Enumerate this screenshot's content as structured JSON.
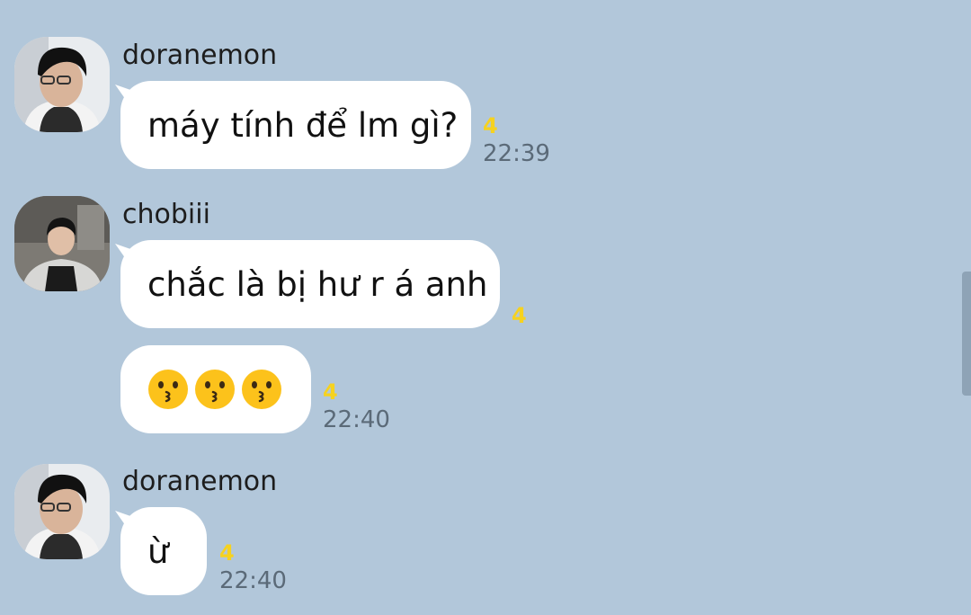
{
  "messages": [
    {
      "sender": "doranemon",
      "avatar_icon": "profile-photo-doranemon",
      "bubbles": [
        {
          "text": "máy tính để lm gì?",
          "unread": "4",
          "time": "22:39"
        }
      ]
    },
    {
      "sender": "chobiii",
      "avatar_icon": "profile-photo-chobiii",
      "bubbles": [
        {
          "text": "chắc là bị hư r á anh",
          "unread": "4",
          "time": ""
        },
        {
          "text": "",
          "emoji": [
            "kissing-face-emoji",
            "kissing-face-emoji",
            "kissing-face-emoji"
          ],
          "unread": "4",
          "time": "22:40"
        }
      ]
    },
    {
      "sender": "doranemon",
      "avatar_icon": "profile-photo-doranemon",
      "bubbles": [
        {
          "text": "ừ",
          "unread": "4",
          "time": "22:40"
        }
      ]
    }
  ],
  "colors": {
    "background": "#b2c7da",
    "bubble": "#ffffff",
    "unread_count": "#f6d21f",
    "timestamp": "#5b6a78"
  }
}
